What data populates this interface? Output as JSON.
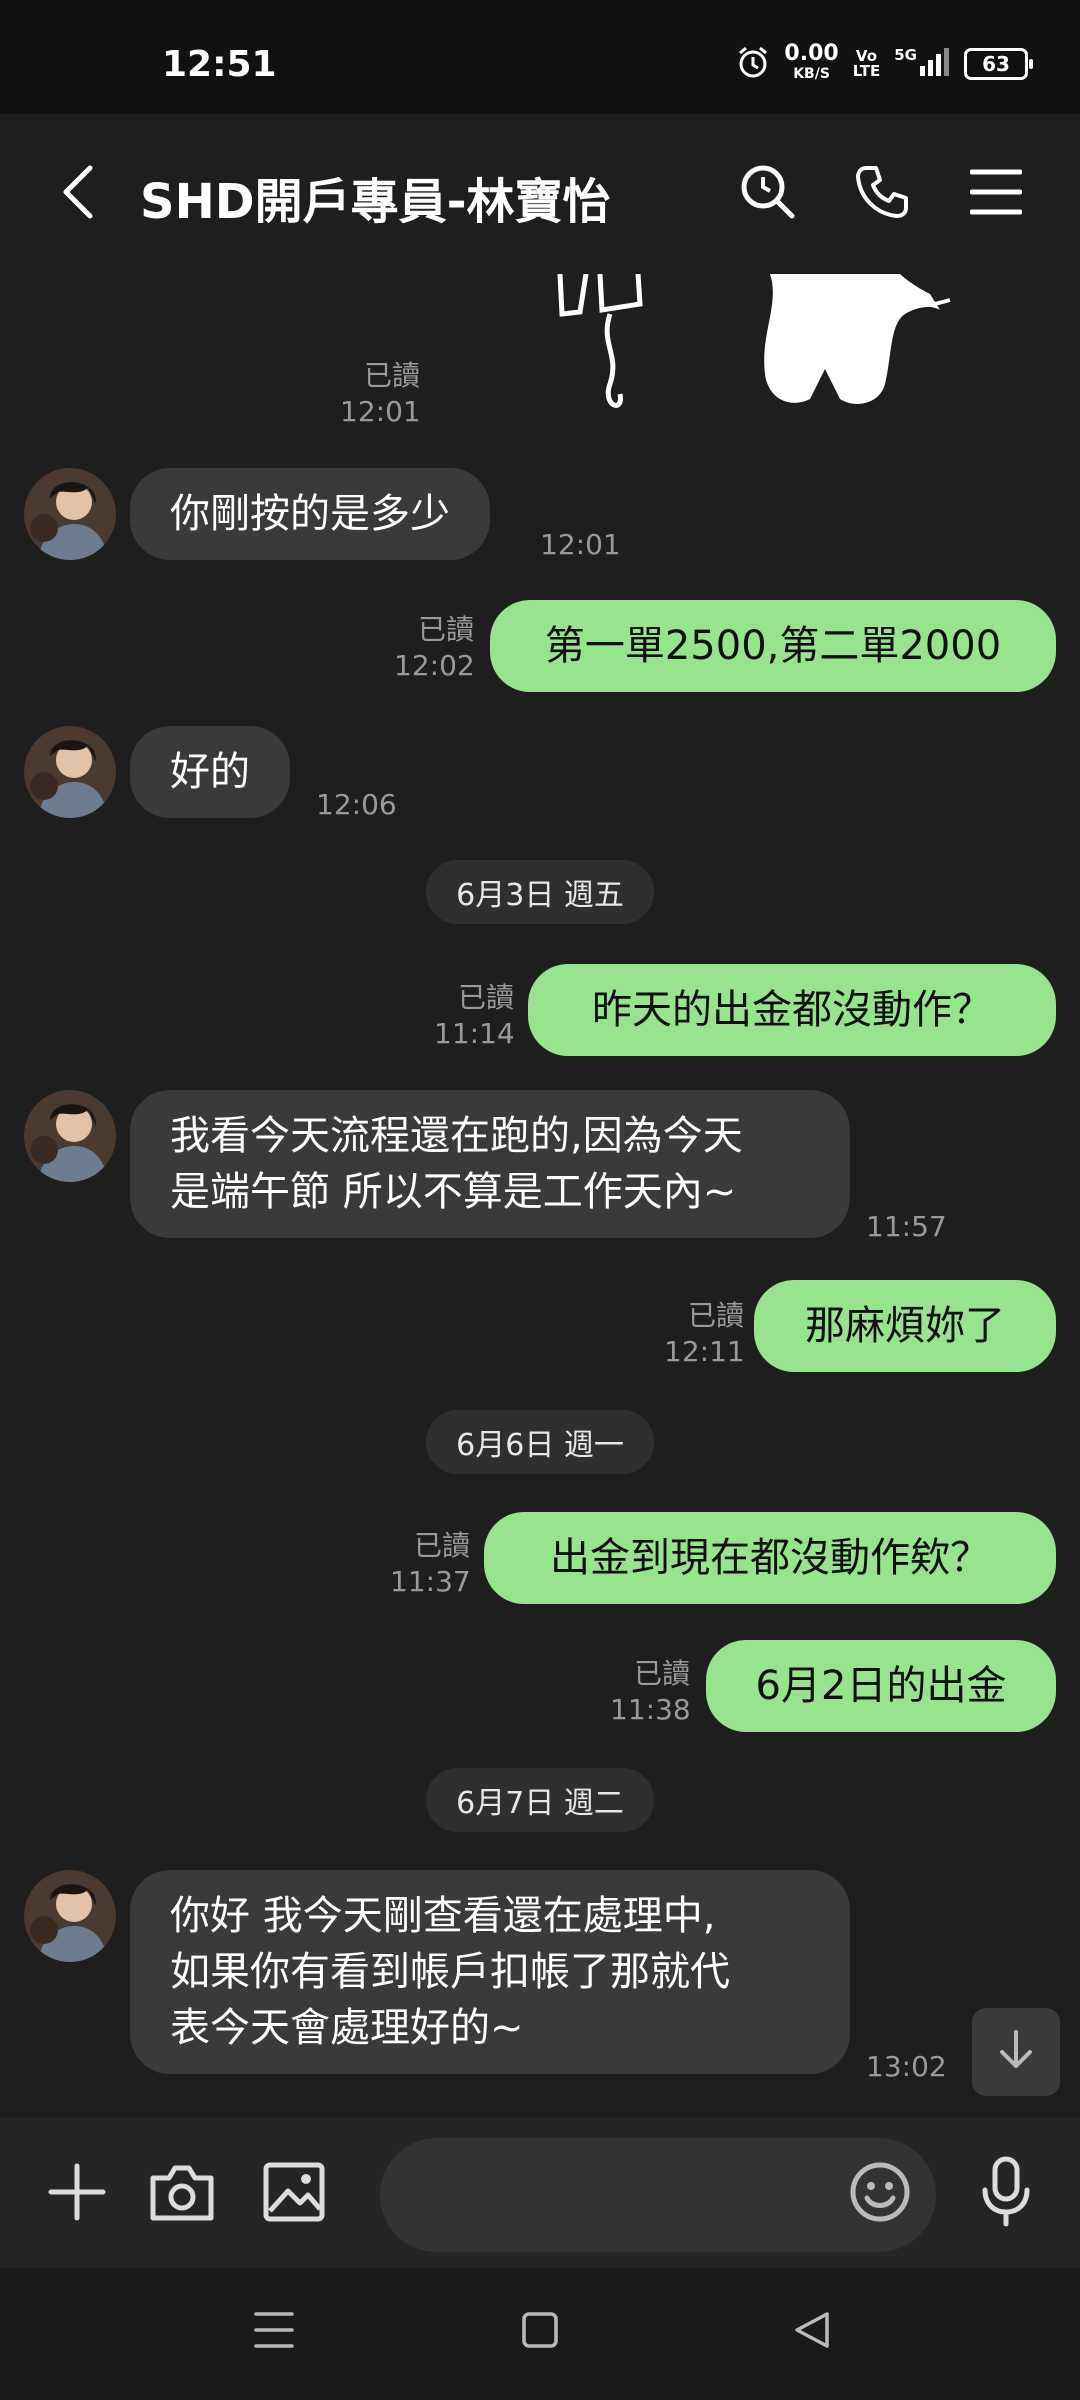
{
  "status_bar": {
    "time": "12:51",
    "net_speed_value": "0.00",
    "net_speed_unit": "KB/S",
    "volte_top": "Vo",
    "volte_bottom": "LTE",
    "network": "5G",
    "battery": "63"
  },
  "header": {
    "title": "SHD開戶專員-林寶怡",
    "icons": [
      "back-chevron-icon",
      "search-icon",
      "phone-icon",
      "menu-icon"
    ]
  },
  "messages": {
    "m0": {
      "read": "已讀",
      "time": "12:01"
    },
    "m1": {
      "text": "你剛按的是多少",
      "time": "12:01"
    },
    "m2": {
      "text": "第一單2500,第二單2000",
      "read": "已讀",
      "time": "12:02"
    },
    "m3": {
      "text": "好的",
      "time": "12:06"
    },
    "d1": "6月3日 週五",
    "m4": {
      "text": "昨天的出金都沒動作？",
      "read": "已讀",
      "time": "11:14"
    },
    "m5": {
      "line1": "我看今天流程還在跑的,因為今天",
      "line2": "是端午節 所以不算是工作天內~",
      "time": "11:57"
    },
    "m6": {
      "text": "那麻煩妳了",
      "read": "已讀",
      "time": "12:11"
    },
    "d2": "6月6日 週一",
    "m7": {
      "text": "出金到現在都沒動作欸？",
      "read": "已讀",
      "time": "11:37"
    },
    "m8": {
      "text": "6月2日的出金",
      "read": "已讀",
      "time": "11:38"
    },
    "d3": "6月7日 週二",
    "m9": {
      "line1": "你好 我今天剛查看還在處理中,",
      "line2": "如果你有看到帳戶扣帳了那就代",
      "line3": "表今天會處理好的~",
      "time": "13:02"
    }
  },
  "input_bar": {
    "placeholder": ""
  },
  "colors": {
    "outgoing_bubble": "#98e38d",
    "incoming_bubble": "#3a3a3a",
    "background": "#1e1e1e"
  }
}
